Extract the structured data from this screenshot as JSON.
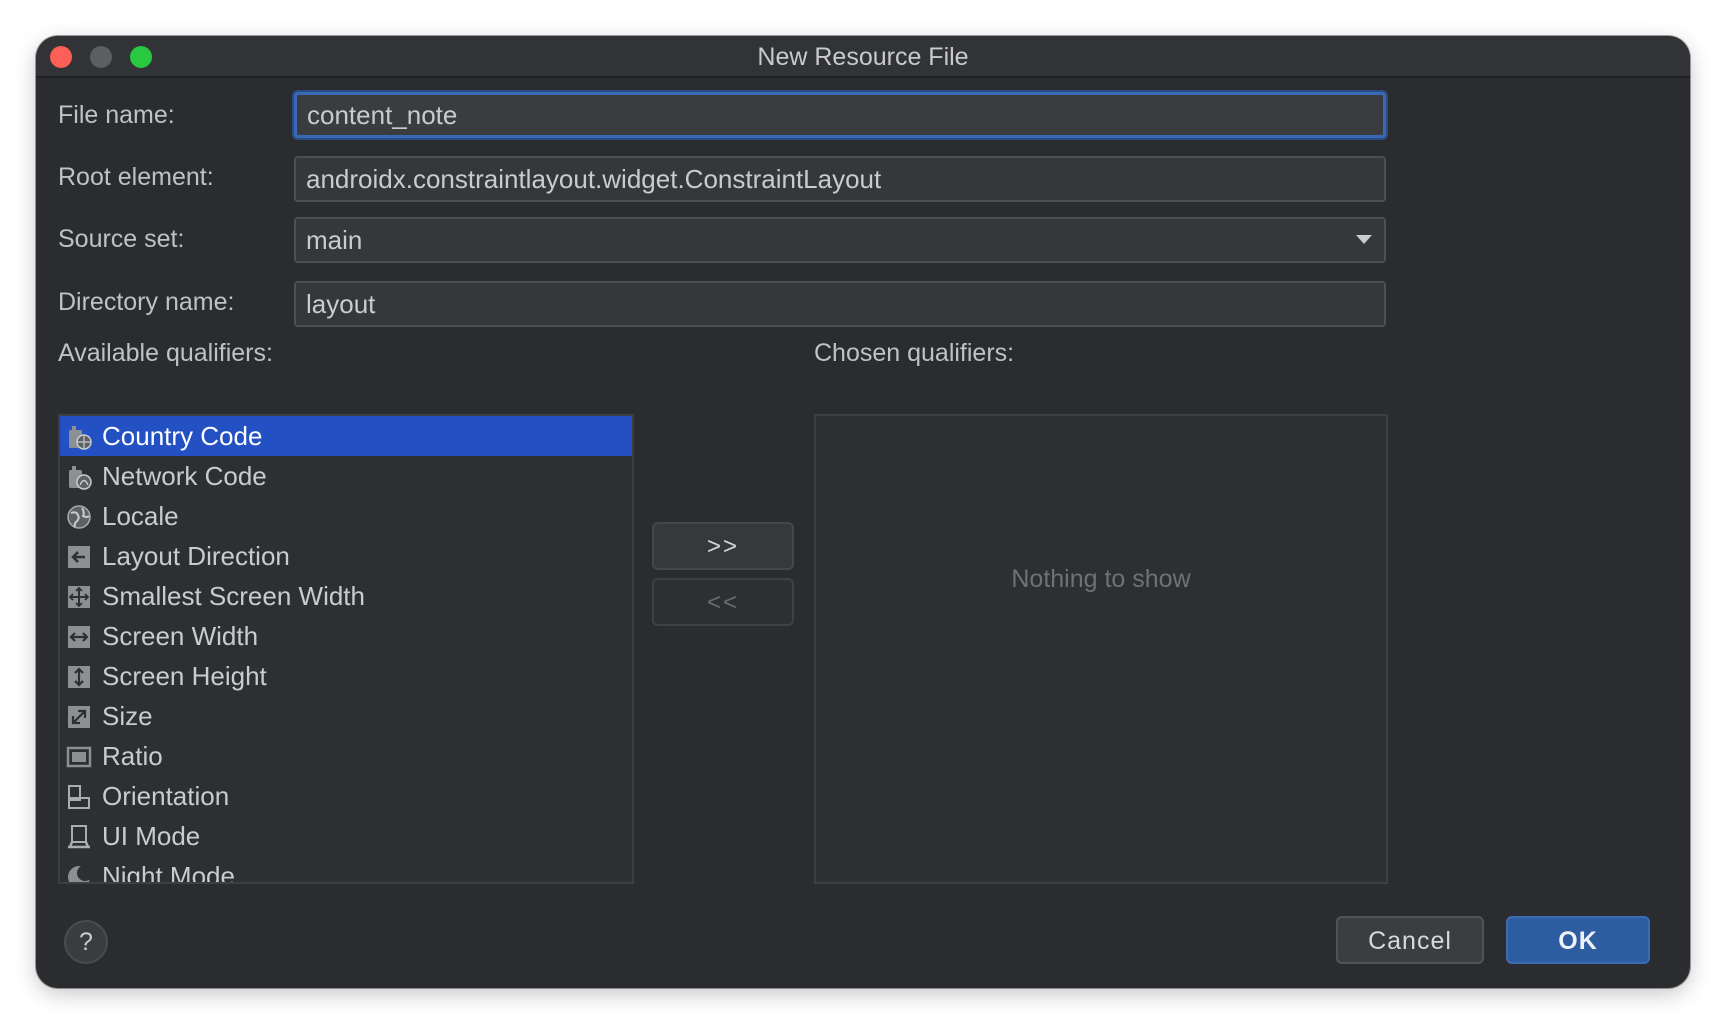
{
  "window": {
    "title": "New Resource File"
  },
  "form": {
    "file_name_label": "File name:",
    "file_name_value": "content_note",
    "root_element_label": "Root element:",
    "root_element_value": "androidx.constraintlayout.widget.ConstraintLayout",
    "source_set_label": "Source set:",
    "source_set_value": "main",
    "directory_name_label": "Directory name:",
    "directory_name_value": "layout"
  },
  "qualifiers": {
    "available_label": "Available qualifiers:",
    "chosen_label": "Chosen qualifiers:",
    "chosen_empty_text": "Nothing to show",
    "selected_index": 0,
    "items": [
      {
        "label": "Country Code",
        "icon": "country-code-icon"
      },
      {
        "label": "Network Code",
        "icon": "network-code-icon"
      },
      {
        "label": "Locale",
        "icon": "globe-icon"
      },
      {
        "label": "Layout Direction",
        "icon": "layout-direction-icon"
      },
      {
        "label": "Smallest Screen Width",
        "icon": "smallest-screen-width-icon"
      },
      {
        "label": "Screen Width",
        "icon": "screen-width-icon"
      },
      {
        "label": "Screen Height",
        "icon": "screen-height-icon"
      },
      {
        "label": "Size",
        "icon": "size-icon"
      },
      {
        "label": "Ratio",
        "icon": "ratio-icon"
      },
      {
        "label": "Orientation",
        "icon": "orientation-icon"
      },
      {
        "label": "UI Mode",
        "icon": "ui-mode-icon"
      },
      {
        "label": "Night Mode",
        "icon": "night-mode-icon"
      }
    ]
  },
  "controls": {
    "add_label": ">>",
    "remove_label": "<<",
    "help_label": "?",
    "cancel_label": "Cancel",
    "ok_label": "OK"
  },
  "colors": {
    "selection": "#2350c2",
    "focus_ring": "#3a6ab5",
    "ok_button": "#2d5ca0"
  }
}
